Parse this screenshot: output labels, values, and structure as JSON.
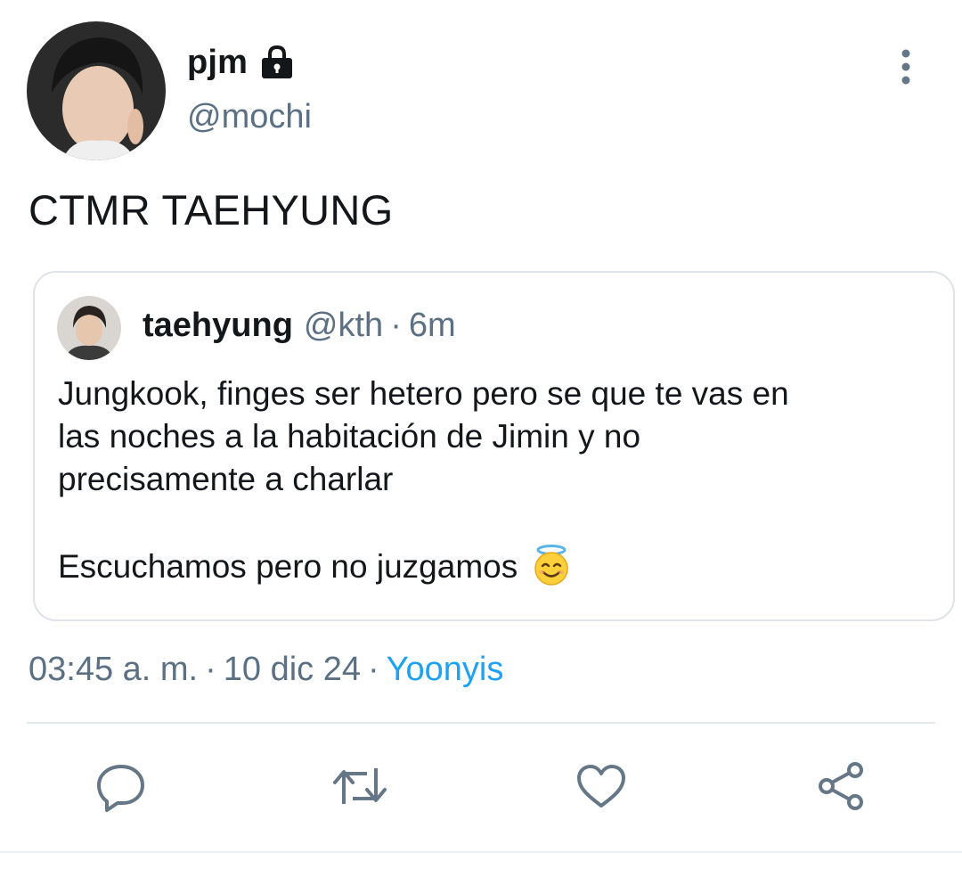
{
  "tweet": {
    "author": {
      "display_name": "pjm",
      "handle": "@mochi",
      "protected_icon": "lock-icon"
    },
    "text": "CTMR TAEHYUNG",
    "quoted": {
      "display_name": "taehyung",
      "handle": "@kth",
      "separator": "·",
      "time": "6m",
      "lines": [
        "Jungkook, finges ser hetero pero se que te vas en",
        "las noches a la habitación de Jimin y no",
        "precisamente a charlar"
      ],
      "second_paragraph": "Escuchamos pero no juzgamos",
      "emoji": "smiling-face-with-halo-icon"
    },
    "meta": {
      "time": "03:45 a. m.",
      "separator": "·",
      "date": "10 dic 24",
      "source": "Yoonyis"
    }
  },
  "actions": [
    {
      "name": "reply",
      "icon": "reply-icon"
    },
    {
      "name": "retweet",
      "icon": "retweet-icon"
    },
    {
      "name": "like",
      "icon": "heart-icon"
    },
    {
      "name": "share",
      "icon": "share-icon"
    }
  ],
  "colors": {
    "text_primary": "#14171a",
    "text_secondary": "#5b7083",
    "link": "#1da1f2",
    "icon_gray": "#657786",
    "border": "#dde3e8"
  }
}
